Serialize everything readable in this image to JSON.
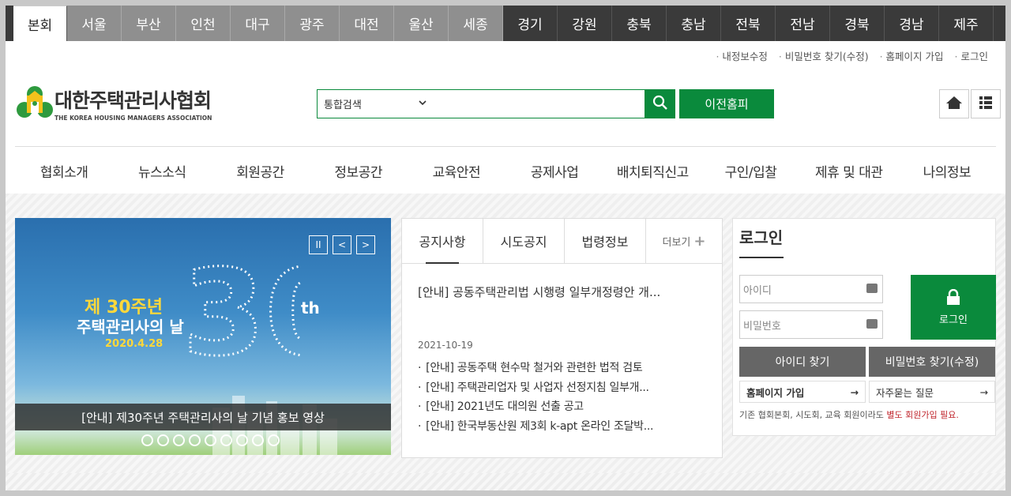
{
  "regions": [
    {
      "label": "본회",
      "kind": "active"
    },
    {
      "label": "서울",
      "kind": "metro"
    },
    {
      "label": "부산",
      "kind": "metro"
    },
    {
      "label": "인천",
      "kind": "metro"
    },
    {
      "label": "대구",
      "kind": "metro"
    },
    {
      "label": "광주",
      "kind": "metro"
    },
    {
      "label": "대전",
      "kind": "metro"
    },
    {
      "label": "울산",
      "kind": "metro"
    },
    {
      "label": "세종",
      "kind": "metro"
    },
    {
      "label": "경기",
      "kind": "province"
    },
    {
      "label": "강원",
      "kind": "province"
    },
    {
      "label": "충북",
      "kind": "province"
    },
    {
      "label": "충남",
      "kind": "province"
    },
    {
      "label": "전북",
      "kind": "province"
    },
    {
      "label": "전남",
      "kind": "province"
    },
    {
      "label": "경북",
      "kind": "province"
    },
    {
      "label": "경남",
      "kind": "province"
    },
    {
      "label": "제주",
      "kind": "province"
    }
  ],
  "util_links": [
    "내정보수정",
    "비밀번호 찾기(수정)",
    "홈페이지 가입",
    "로그인"
  ],
  "logo": {
    "ko": "대한주택관리사협회",
    "en": "THE KOREA HOUSING MANAGERS ASSOCIATION"
  },
  "search": {
    "category": "통합검색",
    "prev_home": "이전홈피"
  },
  "gnb": [
    "협회소개",
    "뉴스소식",
    "회원공간",
    "정보공간",
    "교육안전",
    "공제사업",
    "배치퇴직신고",
    "구인/입찰",
    "제휴 및 대관",
    "나의정보"
  ],
  "banner": {
    "line1": "제 30주년",
    "line2": "주택관리사의 날",
    "date": "2020.4.28",
    "big": "30",
    "suffix": "th",
    "caption": "[안내] 제30주년 주택관리사의 날 기념 홍보 영상",
    "pause": "II",
    "prev": "<",
    "next": ">"
  },
  "notice": {
    "tabs": [
      "공지사항",
      "시도공지",
      "법령정보"
    ],
    "more": "더보기",
    "headline": "[안내] 공동주택관리법 시행령 일부개정령안 개...",
    "date": "2021-10-19",
    "items": [
      "[안내] 공동주택 현수막 철거와 관련한 법적 검토",
      "[안내] 주택관리업자 및 사업자 선정지침 일부개...",
      "[안내] 2021년도 대의원 선출 공고",
      "[안내] 한국부동산원 제3회 k-apt 온라인 조달박..."
    ]
  },
  "login": {
    "title": "로그인",
    "id_placeholder": "아이디",
    "pw_placeholder": "비밀번호",
    "login_label": "로그인",
    "find_id": "아이디 찾기",
    "find_pw": "비밀번호 찾기(수정)",
    "join": "홈페이지 가입",
    "faq": "자주묻는 질문",
    "note_prefix": "기존 협회본회, 시도회, 교육 회원이라도 ",
    "note_red": "별도 회원가입 필요."
  },
  "colors": {
    "green": "#0a8a3c",
    "dark": "#3a3a3a",
    "metro": "#8f8f8f",
    "red": "#c0262d"
  }
}
